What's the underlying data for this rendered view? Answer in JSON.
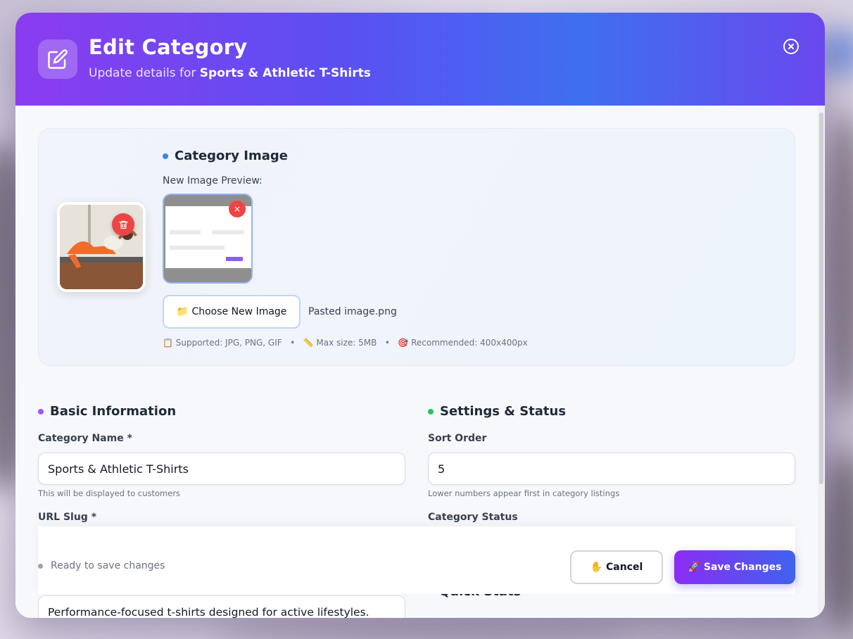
{
  "header": {
    "title": "Edit Category",
    "subtitle_prefix": "Update details for ",
    "subtitle_name": "Sports & Athletic T-Shirts"
  },
  "image_section": {
    "title": "Category Image",
    "preview_label": "New Image Preview:",
    "preview_remove": "×",
    "choose_button": "📁 Choose New Image",
    "file_name": "Pasted image.png",
    "hint_supported": "📋 Supported: JPG, PNG, GIF",
    "hint_max": "📏 Max size: 5MB",
    "hint_recommended": "🎯 Recommended: 400x400px",
    "hint_sep": "•"
  },
  "basic_info": {
    "title": "Basic Information",
    "name_label": "Category Name *",
    "name_value": "Sports & Athletic T-Shirts",
    "name_help": "This will be displayed to customers",
    "slug_label": "URL Slug *",
    "description_value": "Performance-focused t-shirts designed for active lifestyles. Moisture-"
  },
  "settings": {
    "title": "Settings & Status",
    "sort_label": "Sort Order",
    "sort_value": "5",
    "sort_help": "Lower numbers appear first in category listings",
    "status_label": "Category Status",
    "quick_stats_title": "Quick Stats"
  },
  "footer": {
    "status_text": "Ready to save changes",
    "cancel_label": "✋ Cancel",
    "save_label": "🚀 Save Changes"
  },
  "colors": {
    "header_gradient_start": "#8b3cf0",
    "header_gradient_end": "#3f6ff0",
    "image_dot": "#3b82f6",
    "basic_dot": "#a855f7",
    "settings_dot": "#22c55e",
    "danger": "#ef4444"
  },
  "icons": {
    "header": "edit-icon",
    "close": "close-circle-icon",
    "trash": "trash-icon"
  }
}
